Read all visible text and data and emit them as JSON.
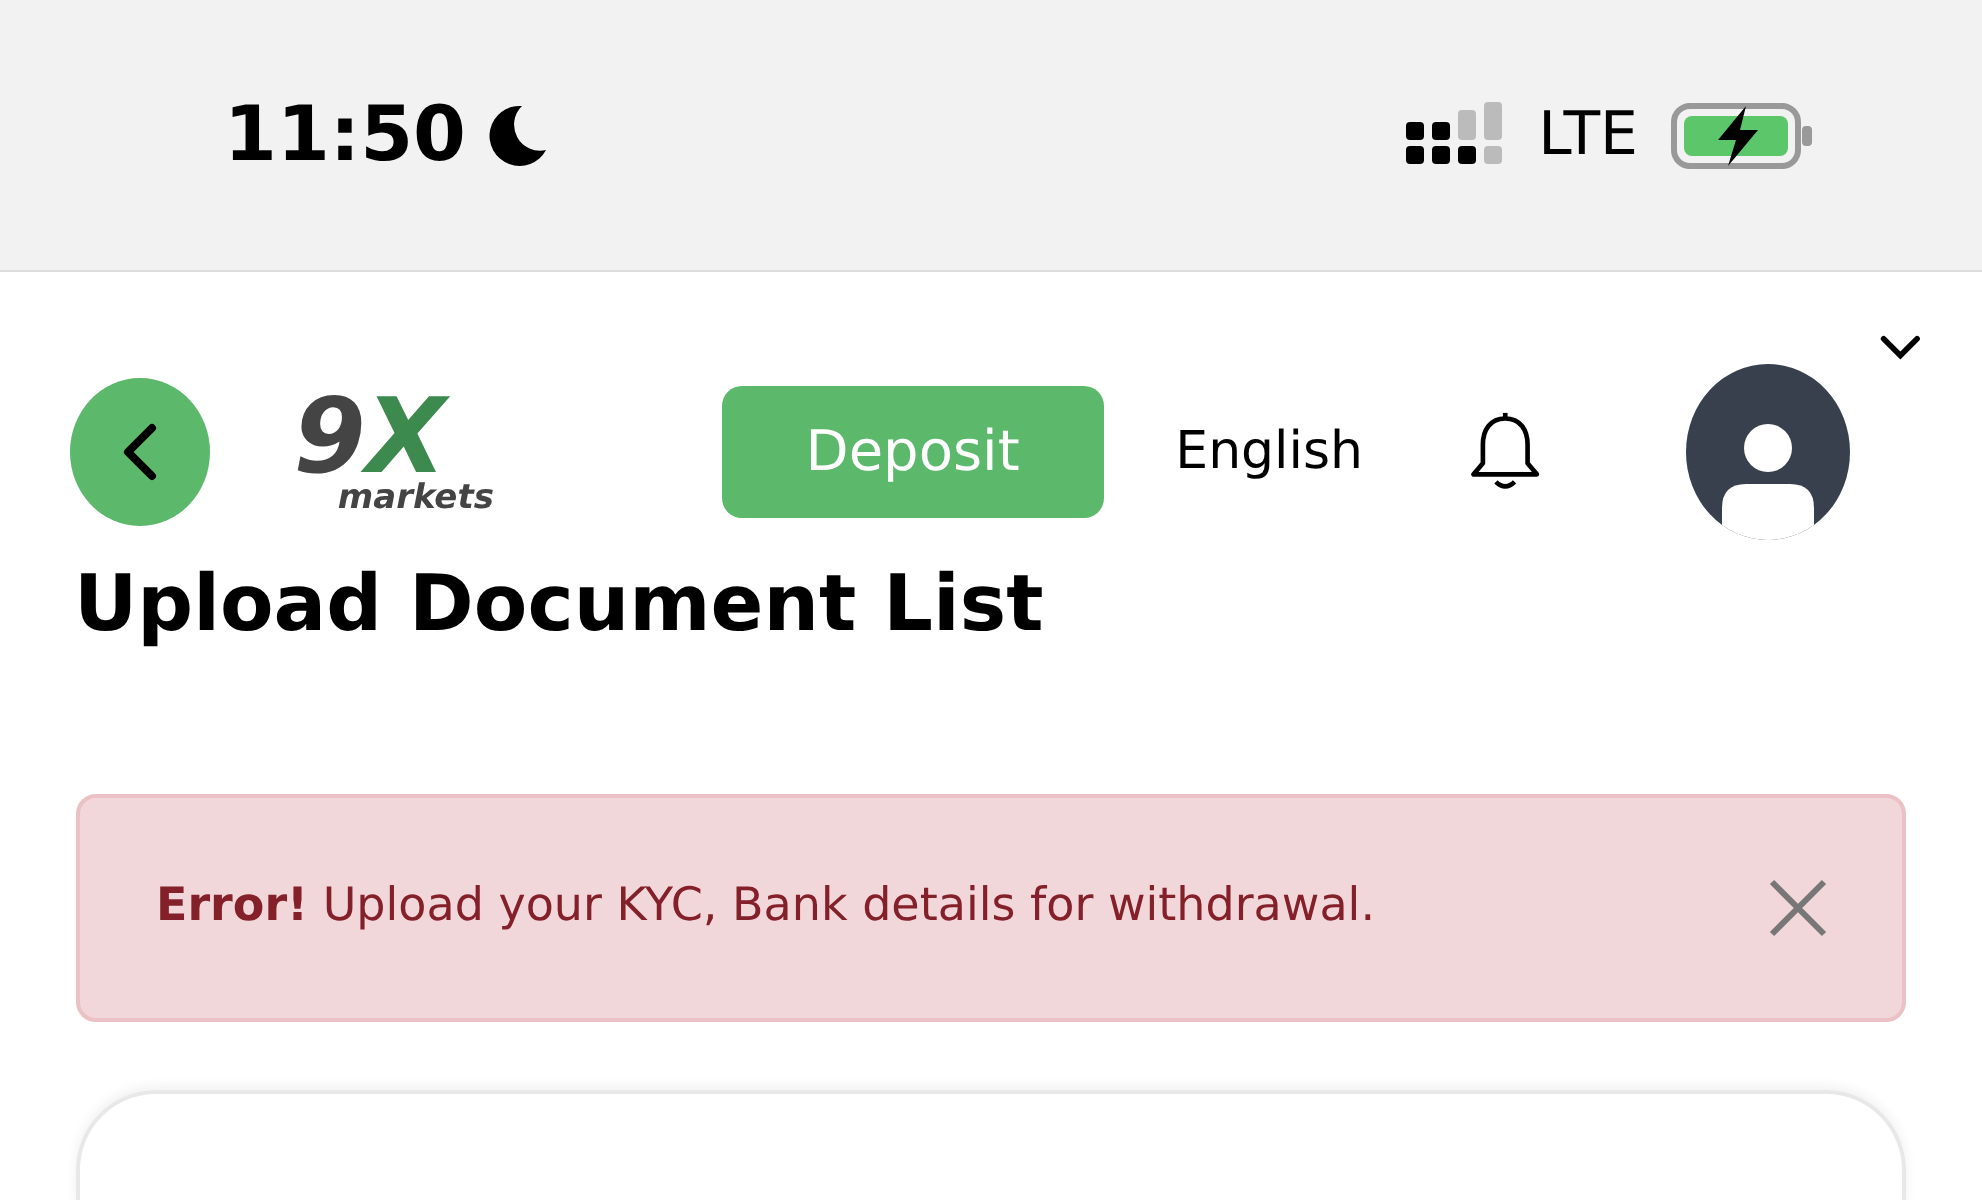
{
  "status_bar": {
    "time": "11:50",
    "network": "LTE"
  },
  "header": {
    "logo": {
      "mark": "9X",
      "word": "markets"
    },
    "deposit_button": "Deposit",
    "language": "English"
  },
  "page_title": "Upload Document List",
  "alert": {
    "text": "**Error!** Upload your KYC, Bank details for withdrawal.",
    "dismissible": true
  }
}
